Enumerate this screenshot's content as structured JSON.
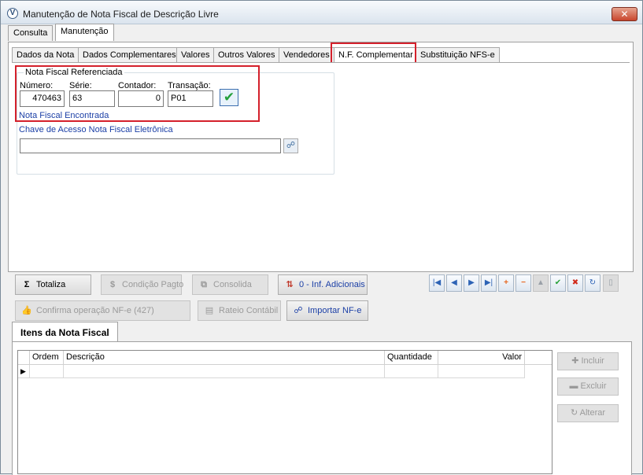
{
  "window": {
    "title": "Manutenção de Nota Fiscal de Descrição Livre",
    "close_label": "✕"
  },
  "top_tabs": [
    "Consulta",
    "Manutenção"
  ],
  "inner_tabs": [
    "Dados da Nota",
    "Dados Complementares",
    "Valores",
    "Outros Valores",
    "Vendedores",
    "N.F. Complementar",
    "Substituição NFS-e"
  ],
  "nf_ref": {
    "group_title": "Nota Fiscal Referenciada",
    "numero_label": "Número:",
    "numero_value": "470463",
    "serie_label": "Série:",
    "serie_value": "63",
    "contador_label": "Contador:",
    "contador_value": "0",
    "transacao_label": "Transação:",
    "transacao_value": "P01",
    "status": "Nota Fiscal Encontrada",
    "chave_label": "Chave de Acesso Nota Fiscal Eletrônica",
    "chave_value": ""
  },
  "actions": {
    "totaliza": "Totaliza",
    "condicao": "Condição Pagto",
    "consolida": "Consolida",
    "inf_adicionais": "0 - Inf. Adicionais",
    "confirma": "Confirma operação NF-e (427)",
    "rateio": "Rateio Contábil",
    "importar": "Importar NF-e"
  },
  "nav_icons": [
    "first-icon",
    "prev-icon",
    "next-icon",
    "last-icon",
    "plus-icon",
    "minus-icon",
    "up-icon",
    "check-icon",
    "x-icon",
    "refresh-icon",
    "page-icon"
  ],
  "items": {
    "tab_label": "Itens da Nota Fiscal",
    "columns": [
      "Ordem",
      "Descrição",
      "Quantidade",
      "Valor"
    ]
  },
  "side_buttons": {
    "incluir": "Incluir",
    "excluir": "Excluir",
    "alterar": "Alterar"
  },
  "colors": {
    "highlight": "#d4202b",
    "link_blue": "#1b3fa6",
    "confirm_green": "#23a03a"
  }
}
